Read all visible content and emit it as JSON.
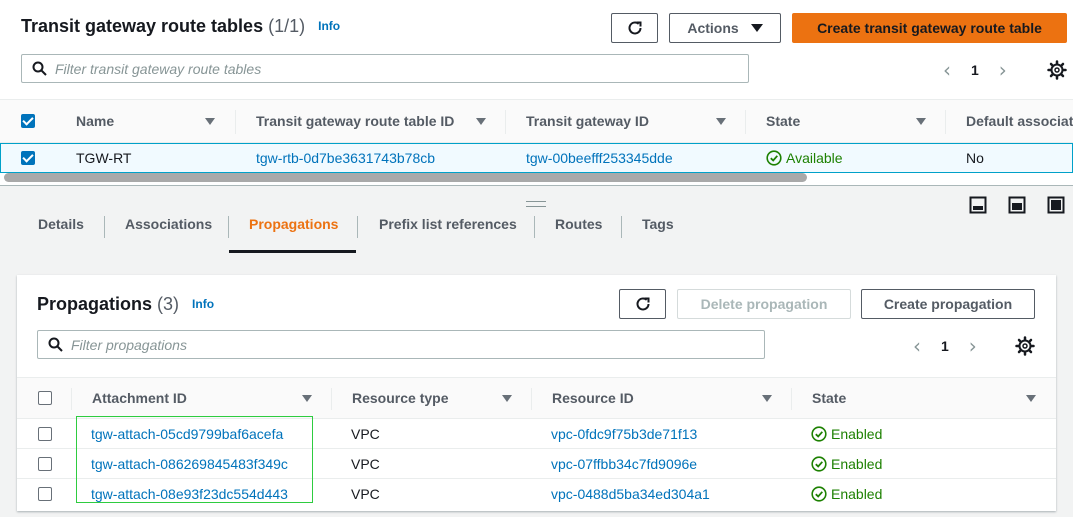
{
  "route_tables": {
    "title": "Transit gateway route tables",
    "count": "(1/1)",
    "info": "Info",
    "actions_label": "Actions",
    "create_label": "Create transit gateway route table",
    "search_placeholder": "Filter transit gateway route tables",
    "page": "1",
    "columns": [
      "Name",
      "Transit gateway route table ID",
      "Transit gateway ID",
      "State",
      "Default associat"
    ],
    "rows": [
      {
        "name": "TGW-RT",
        "route_table_id": "tgw-rtb-0d7be3631743b78cb",
        "gateway_id": "tgw-00beefff253345dde",
        "state": "Available",
        "default_association": "No"
      }
    ]
  },
  "tabs": [
    "Details",
    "Associations",
    "Propagations",
    "Prefix list references",
    "Routes",
    "Tags"
  ],
  "active_tab": "Propagations",
  "propagations": {
    "title": "Propagations",
    "count": "(3)",
    "info": "Info",
    "delete_label": "Delete propagation",
    "create_label": "Create propagation",
    "search_placeholder": "Filter propagations",
    "page": "1",
    "columns": [
      "Attachment ID",
      "Resource type",
      "Resource ID",
      "State"
    ],
    "rows": [
      {
        "attachment_id": "tgw-attach-05cd9799baf6acefa",
        "resource_type": "VPC",
        "resource_id": "vpc-0fdc9f75b3de71f13",
        "state": "Enabled"
      },
      {
        "attachment_id": "tgw-attach-086269845483f349c",
        "resource_type": "VPC",
        "resource_id": "vpc-07ffbb34c7fd9096e",
        "state": "Enabled"
      },
      {
        "attachment_id": "tgw-attach-08e93f23dc554d443",
        "resource_type": "VPC",
        "resource_id": "vpc-0488d5ba34ed304a1",
        "state": "Enabled"
      }
    ]
  },
  "colors": {
    "primary": "#ec7211",
    "link": "#0073bb",
    "success": "#1d8102",
    "highlight": "#2ecc40"
  }
}
